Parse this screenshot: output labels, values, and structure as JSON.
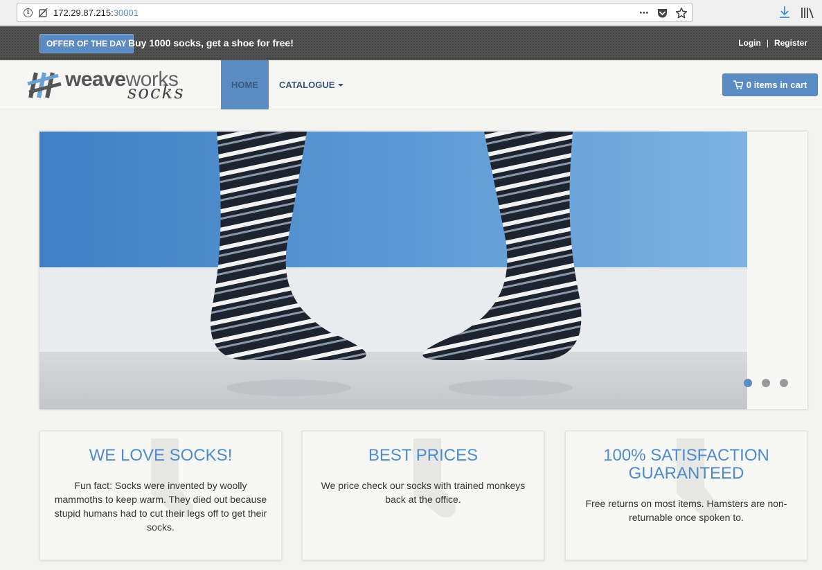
{
  "browser": {
    "url_host": "172.29.87.215:",
    "url_port": "30001",
    "more_icon": "⋯"
  },
  "topbar": {
    "offer_badge": "OFFER OF THE DAY",
    "offer_text": "Buy 1000 socks, get a shoe for free!",
    "login": "Login",
    "separator": "|",
    "register": "Register"
  },
  "navbar": {
    "logo_weave": "weave",
    "logo_works": "works",
    "logo_socks": "socks",
    "home": "HOME",
    "catalogue": "CATALOGUE",
    "cart": "0 items in cart"
  },
  "hero": {
    "slides": 3,
    "active_slide": 1
  },
  "features": [
    {
      "title": "WE LOVE SOCKS!",
      "text": "Fun fact: Socks were invented by woolly mammoths to keep warm. They died out because stupid humans had to cut their legs off to get their socks."
    },
    {
      "title": "BEST PRICES",
      "text": "We price check our socks with trained monkeys back at the office."
    },
    {
      "title": "100% SATISFACTION GUARANTEED",
      "text": "Free returns on most items. Hamsters are non-returnable once spoken to."
    }
  ],
  "colors": {
    "accent": "#5a8bc3",
    "heading": "#4f8cc9",
    "topbar": "#505050"
  }
}
